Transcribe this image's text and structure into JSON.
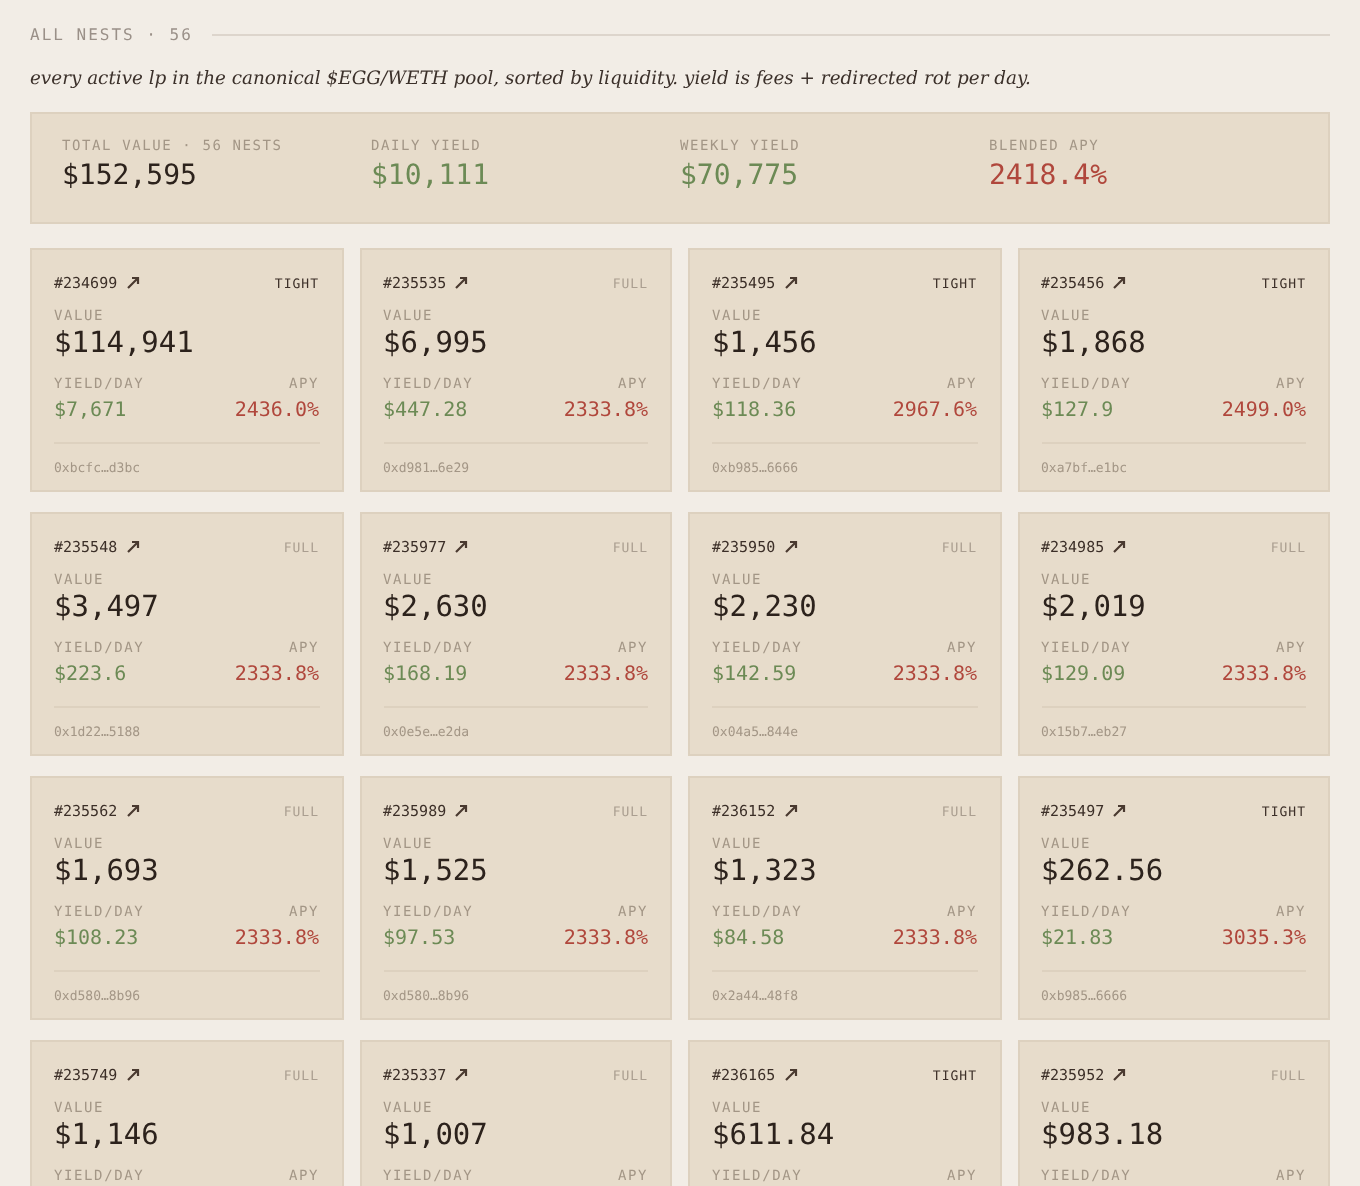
{
  "header": {
    "title": "ALL NESTS · 56",
    "description": "every active lp in the canonical $EGG/WETH pool, sorted by liquidity. yield is fees + redirected rot per day."
  },
  "summary": [
    {
      "label": "TOTAL VALUE · 56 NESTS",
      "value": "$152,595",
      "kind": "neutral"
    },
    {
      "label": "DAILY YIELD",
      "value": "$10,111",
      "kind": "yield"
    },
    {
      "label": "WEEKLY YIELD",
      "value": "$70,775",
      "kind": "yield"
    },
    {
      "label": "BLENDED APY",
      "value": "2418.4%",
      "kind": "apy"
    }
  ],
  "nests": [
    {
      "id": "#234699",
      "range": "TIGHT",
      "tight": true,
      "value_label": "VALUE",
      "value": "$114,941",
      "yield_label": "YIELD/DAY",
      "apy_label": "APY",
      "yield": "$7,671",
      "apy": "2436.0%",
      "address": "0xbcfc…d3bc"
    },
    {
      "id": "#235535",
      "range": "FULL",
      "tight": false,
      "value_label": "VALUE",
      "value": "$6,995",
      "yield_label": "YIELD/DAY",
      "apy_label": "APY",
      "yield": "$447.28",
      "apy": "2333.8%",
      "address": "0xd981…6e29"
    },
    {
      "id": "#235495",
      "range": "TIGHT",
      "tight": true,
      "value_label": "VALUE",
      "value": "$1,456",
      "yield_label": "YIELD/DAY",
      "apy_label": "APY",
      "yield": "$118.36",
      "apy": "2967.6%",
      "address": "0xb985…6666"
    },
    {
      "id": "#235456",
      "range": "TIGHT",
      "tight": true,
      "value_label": "VALUE",
      "value": "$1,868",
      "yield_label": "YIELD/DAY",
      "apy_label": "APY",
      "yield": "$127.9",
      "apy": "2499.0%",
      "address": "0xa7bf…e1bc"
    },
    {
      "id": "#235548",
      "range": "FULL",
      "tight": false,
      "value_label": "VALUE",
      "value": "$3,497",
      "yield_label": "YIELD/DAY",
      "apy_label": "APY",
      "yield": "$223.6",
      "apy": "2333.8%",
      "address": "0x1d22…5188"
    },
    {
      "id": "#235977",
      "range": "FULL",
      "tight": false,
      "value_label": "VALUE",
      "value": "$2,630",
      "yield_label": "YIELD/DAY",
      "apy_label": "APY",
      "yield": "$168.19",
      "apy": "2333.8%",
      "address": "0x0e5e…e2da"
    },
    {
      "id": "#235950",
      "range": "FULL",
      "tight": false,
      "value_label": "VALUE",
      "value": "$2,230",
      "yield_label": "YIELD/DAY",
      "apy_label": "APY",
      "yield": "$142.59",
      "apy": "2333.8%",
      "address": "0x04a5…844e"
    },
    {
      "id": "#234985",
      "range": "FULL",
      "tight": false,
      "value_label": "VALUE",
      "value": "$2,019",
      "yield_label": "YIELD/DAY",
      "apy_label": "APY",
      "yield": "$129.09",
      "apy": "2333.8%",
      "address": "0x15b7…eb27"
    },
    {
      "id": "#235562",
      "range": "FULL",
      "tight": false,
      "value_label": "VALUE",
      "value": "$1,693",
      "yield_label": "YIELD/DAY",
      "apy_label": "APY",
      "yield": "$108.23",
      "apy": "2333.8%",
      "address": "0xd580…8b96"
    },
    {
      "id": "#235989",
      "range": "FULL",
      "tight": false,
      "value_label": "VALUE",
      "value": "$1,525",
      "yield_label": "YIELD/DAY",
      "apy_label": "APY",
      "yield": "$97.53",
      "apy": "2333.8%",
      "address": "0xd580…8b96"
    },
    {
      "id": "#236152",
      "range": "FULL",
      "tight": false,
      "value_label": "VALUE",
      "value": "$1,323",
      "yield_label": "YIELD/DAY",
      "apy_label": "APY",
      "yield": "$84.58",
      "apy": "2333.8%",
      "address": "0x2a44…48f8"
    },
    {
      "id": "#235497",
      "range": "TIGHT",
      "tight": true,
      "value_label": "VALUE",
      "value": "$262.56",
      "yield_label": "YIELD/DAY",
      "apy_label": "APY",
      "yield": "$21.83",
      "apy": "3035.3%",
      "address": "0xb985…6666"
    },
    {
      "id": "#235749",
      "range": "FULL",
      "tight": false,
      "value_label": "VALUE",
      "value": "$1,146",
      "yield_label": "YIELD/DAY",
      "apy_label": "APY"
    },
    {
      "id": "#235337",
      "range": "FULL",
      "tight": false,
      "value_label": "VALUE",
      "value": "$1,007",
      "yield_label": "YIELD/DAY",
      "apy_label": "APY"
    },
    {
      "id": "#236165",
      "range": "TIGHT",
      "tight": true,
      "value_label": "VALUE",
      "value": "$611.84",
      "yield_label": "YIELD/DAY",
      "apy_label": "APY"
    },
    {
      "id": "#235952",
      "range": "FULL",
      "tight": false,
      "value_label": "VALUE",
      "value": "$983.18",
      "yield_label": "YIELD/DAY",
      "apy_label": "APY"
    }
  ]
}
